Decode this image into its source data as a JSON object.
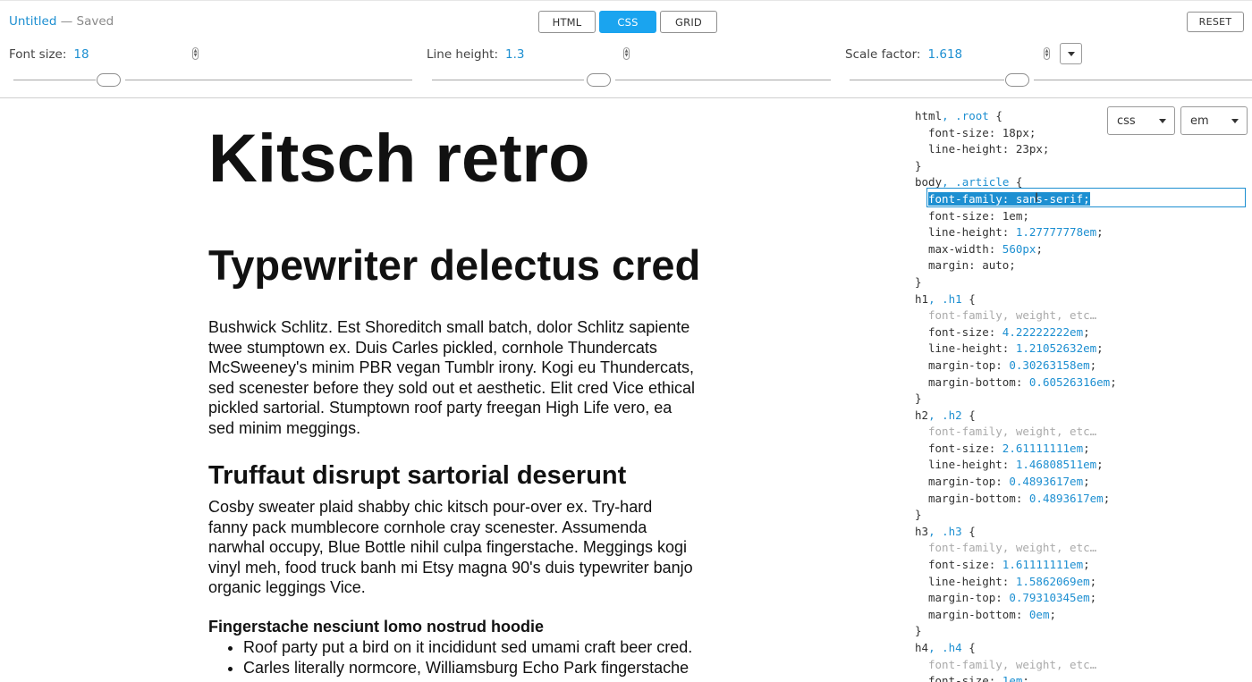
{
  "doc": {
    "name": "Untitled",
    "separator": " — ",
    "status": "Saved"
  },
  "tabs": [
    {
      "label": "HTML",
      "active": false
    },
    {
      "label": "CSS",
      "active": true
    },
    {
      "label": "GRID",
      "active": false
    }
  ],
  "reset_label": "RESET",
  "controls": {
    "font_size": {
      "label": "Font size:",
      "value": "18"
    },
    "line_height": {
      "label": "Line height:",
      "value": "1.3"
    },
    "scale_factor": {
      "label": "Scale factor:",
      "value": "1.618"
    }
  },
  "article": {
    "h1": "Kitsch retro",
    "h2": "Typewriter delectus cred",
    "p1": "Bushwick Schlitz. Est Shoreditch small batch, dolor Schlitz sapiente twee stumptown ex. Duis Carles pickled, cornhole Thundercats McSweeney's minim PBR vegan Tumblr irony. Kogi eu Thundercats, sed scenester before they sold out et aesthetic. Elit cred Vice ethical pickled sartorial. Stumptown roof party freegan High Life vero, ea sed minim meggings.",
    "h3": "Truffaut disrupt sartorial deserunt",
    "p2": "Cosby sweater plaid shabby chic kitsch pour-over ex. Try-hard fanny pack mumblecore cornhole cray scenester. Assumenda narwhal occupy, Blue Bottle nihil culpa fingerstache. Meggings kogi vinyl meh, food truck banh mi Etsy magna 90's duis typewriter banjo organic leggings Vice.",
    "h4": "Fingerstache nesciunt lomo nostrud hoodie",
    "list": [
      "Roof party put a bird on it incididunt sed umami craft beer cred.",
      "Carles literally normcore, Williamsburg Echo Park fingerstache"
    ]
  },
  "format_select": "css",
  "unit_select": "em",
  "css_code": {
    "root_sel": [
      "html",
      ".root"
    ],
    "root_font_size": "font-size: 18px;",
    "root_line_height": "line-height: 23px;",
    "body_sel": [
      "body",
      ".article"
    ],
    "body_font_family": "font-family: sans-serif;",
    "body_font_size": "font-size: 1em;",
    "body_line_height": [
      "line-height: ",
      "1.27777778em",
      ";"
    ],
    "body_max_width": [
      "max-width: ",
      "560px",
      ";"
    ],
    "body_margin": "margin: auto;",
    "placeholder": "font-family, weight, etc…",
    "h1_sel": [
      "h1",
      ".h1"
    ],
    "h1_font_size": [
      "font-size: ",
      "4.22222222em",
      ";"
    ],
    "h1_line_height": [
      "line-height: ",
      "1.21052632em",
      ";"
    ],
    "h1_margin_top": [
      "margin-top: ",
      "0.30263158em",
      ";"
    ],
    "h1_margin_bottom": [
      "margin-bottom: ",
      "0.60526316em",
      ";"
    ],
    "h2_sel": [
      "h2",
      ".h2"
    ],
    "h2_font_size": [
      "font-size: ",
      "2.61111111em",
      ";"
    ],
    "h2_line_height": [
      "line-height: ",
      "1.46808511em",
      ";"
    ],
    "h2_margin_top": [
      "margin-top: ",
      "0.4893617em",
      ";"
    ],
    "h2_margin_bottom": [
      "margin-bottom: ",
      "0.4893617em",
      ";"
    ],
    "h3_sel": [
      "h3",
      ".h3"
    ],
    "h3_font_size": [
      "font-size: ",
      "1.61111111em",
      ";"
    ],
    "h3_line_height": [
      "line-height: ",
      "1.5862069em",
      ";"
    ],
    "h3_margin_top": [
      "margin-top: ",
      "0.79310345em",
      ";"
    ],
    "h3_margin_bottom": [
      "margin-bottom: ",
      "0em",
      ";"
    ],
    "h4_sel": [
      "h4",
      ".h4"
    ],
    "h4_font_size": [
      "font-size: ",
      "1em",
      ";"
    ],
    "open_brace": " {",
    "close_brace": "}",
    "comma": ", "
  },
  "colors": {
    "accent": "#1aa4ef",
    "link": "#1d8fd1"
  },
  "icons": [
    "chevron-down-icon",
    "spinner-arrows-icon",
    "text-cursor-icon"
  ]
}
